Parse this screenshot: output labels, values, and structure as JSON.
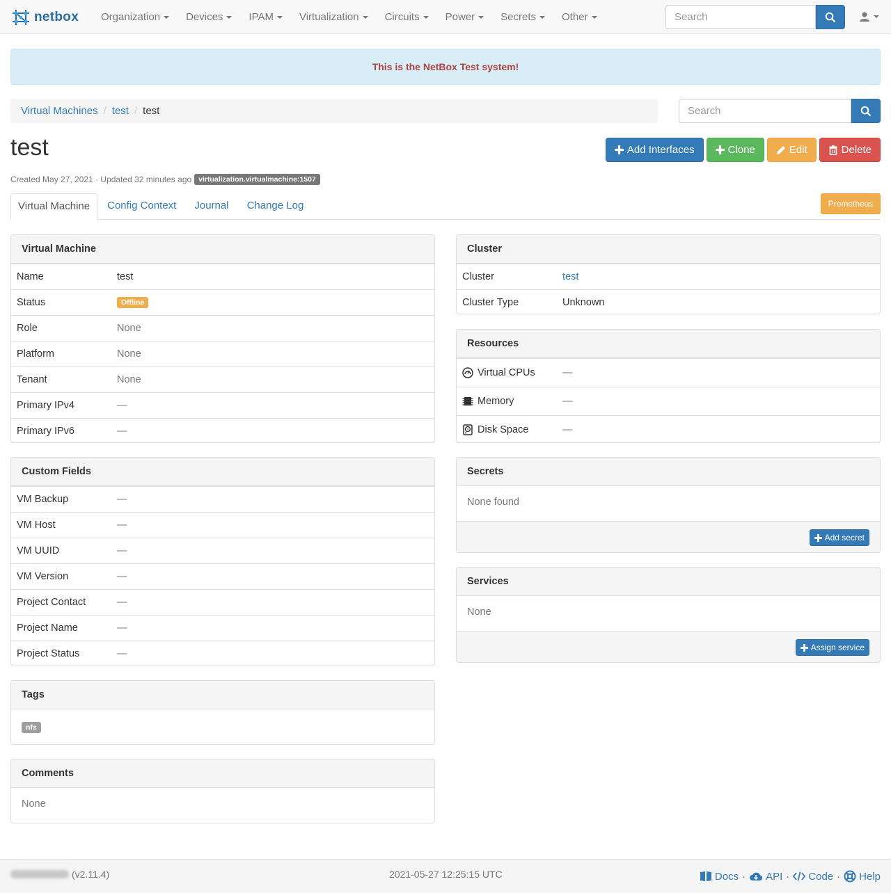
{
  "brand": {
    "name": "netbox"
  },
  "nav": {
    "items": [
      "Organization",
      "Devices",
      "IPAM",
      "Virtualization",
      "Circuits",
      "Power",
      "Secrets",
      "Other"
    ],
    "search_placeholder": "Search"
  },
  "banner": {
    "text": "This is the NetBox Test system!"
  },
  "breadcrumb": {
    "items": [
      "Virtual Machines",
      "test"
    ],
    "active": "test",
    "search_placeholder": "Search"
  },
  "page": {
    "title": "test",
    "meta": "Created May 27, 2021 · Updated 32 minutes ago",
    "object_label": "virtualization.virtualmachine:1507"
  },
  "actions": {
    "add_interfaces": "Add Interfaces",
    "clone": "Clone",
    "edit": "Edit",
    "delete": "Delete"
  },
  "tabs": {
    "items": [
      "Virtual Machine",
      "Config Context",
      "Journal",
      "Change Log"
    ],
    "active_index": 0,
    "prometheus": "Prometheus"
  },
  "vm_panel": {
    "title": "Virtual Machine",
    "rows": [
      {
        "key": "Name",
        "value": "test"
      },
      {
        "key": "Status",
        "value": "Offline"
      },
      {
        "key": "Role",
        "value": "None"
      },
      {
        "key": "Platform",
        "value": "None"
      },
      {
        "key": "Tenant",
        "value": "None"
      },
      {
        "key": "Primary IPv4",
        "value": "—"
      },
      {
        "key": "Primary IPv6",
        "value": "—"
      }
    ]
  },
  "custom_fields_panel": {
    "title": "Custom Fields",
    "rows": [
      {
        "key": "VM Backup",
        "value": "—"
      },
      {
        "key": "VM Host",
        "value": "—"
      },
      {
        "key": "VM UUID",
        "value": "—"
      },
      {
        "key": "VM Version",
        "value": "—"
      },
      {
        "key": "Project Contact",
        "value": "—"
      },
      {
        "key": "Project Name",
        "value": "—"
      },
      {
        "key": "Project Status",
        "value": "—"
      }
    ]
  },
  "tags_panel": {
    "title": "Tags",
    "tags": [
      "nfs"
    ]
  },
  "comments_panel": {
    "title": "Comments",
    "body": "None"
  },
  "cluster_panel": {
    "title": "Cluster",
    "rows": [
      {
        "key": "Cluster",
        "value": "test"
      },
      {
        "key": "Cluster Type",
        "value": "Unknown"
      }
    ]
  },
  "resources_panel": {
    "title": "Resources",
    "rows": [
      {
        "key": "Virtual CPUs",
        "value": "—",
        "icon": "gauge-icon"
      },
      {
        "key": "Memory",
        "value": "—",
        "icon": "chip-icon"
      },
      {
        "key": "Disk Space",
        "value": "—",
        "icon": "harddisk-icon"
      }
    ]
  },
  "secrets_panel": {
    "title": "Secrets",
    "body": "None found",
    "button": "Add secret"
  },
  "services_panel": {
    "title": "Services",
    "body": "None",
    "button": "Assign service"
  },
  "footer": {
    "version": "(v2.11.4)",
    "timestamp": "2021-05-27 12:25:15 UTC",
    "links": [
      "Docs",
      "API",
      "Code",
      "Help"
    ]
  },
  "colors": {
    "primary": "#337ab7",
    "success": "#5cb85c",
    "warning": "#f0ad4e",
    "danger": "#d9534f",
    "banner_text": "#a94442"
  }
}
